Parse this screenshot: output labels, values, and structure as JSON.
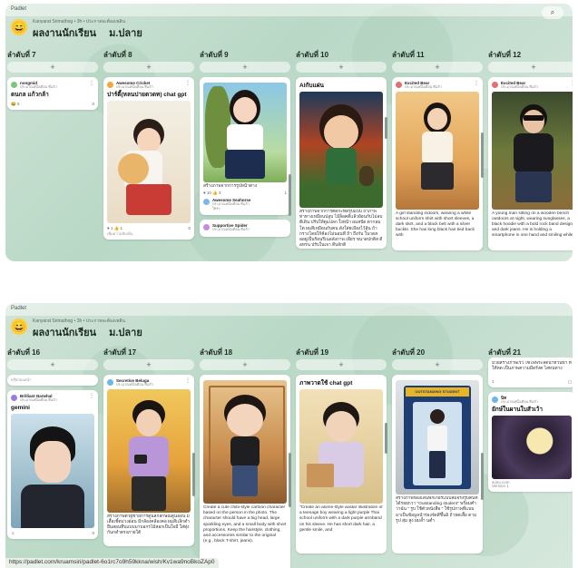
{
  "app_name": "Padlet",
  "search_icon": "search-icon",
  "breadcrumb": "Kanyarat Srimathog • 3h • ประกายจะต้องเพลิน",
  "board_title": "ผลงานนักเรียน  ม.ปลาย",
  "status_url": "https://padlet.com/kruamsiri/padlet-6o1rc7o9h59kkna/wish/Kv1wa9noBkoZAp0",
  "cards_preview": "ตรุ๊ปก่อนหน้า",
  "panel1": {
    "columns": [
      {
        "label": "ลำดับที่ 7"
      },
      {
        "label": "ลำดับที่ 8"
      },
      {
        "label": "ลำดับที่ 9"
      },
      {
        "label": "ลำดับที่ 10"
      },
      {
        "label": "ลำดับที่ 11"
      },
      {
        "label": "ลำดับที่ 12"
      }
    ],
    "cards": {
      "c7": {
        "author": "nongmid",
        "time": "ประมาณหนึ่งเดือน ที่แล้ว",
        "title": "ตนกล แก้วกล้า",
        "reactions": "😂 0",
        "comments": "0"
      },
      "c8": {
        "author": "Awesome Cricket",
        "time": "ประมาณหนึ่งเดือน ที่แล้ว",
        "title": "ปาร์ตี้(หลนปายตวดท) chat gpt",
        "reactions": "♥ 1 👍 1",
        "comments": "0",
        "comment_placeholder": "เพิ่มความคิดเห็น"
      },
      "c9a": {
        "caption": "สร้างภาพจากการรูปหน้าต่าง",
        "reactions": "♥ 10 👍 3",
        "comments": "1"
      },
      "c9b": {
        "author": "Awesome Seahorse",
        "time": "ประมาณหนึ่งเดือน ที่แล้ว",
        "title": "ใครๆ"
      },
      "c9c": {
        "author": "Supportive Spider",
        "time": "ประมาณหนึ่งเดือน ที่แล้ว"
      },
      "c10": {
        "title": "AIกับแผ่น",
        "body": "สร้างภาพจากการตัดกะทัดรูปแบบ ถ้าภาพ ท่าทางเหมือนปลูบ ไม้ล็อคดีแล้วย้อนกับไม่ลบตีเดิน ปรับให้ตูแปลก ใ่งหน้า ผมสปัด ตากลมโต ผมสีเหมือนกับคน ดังใส่ยเมืองไว้ลุ้น ถ้ากรางโดยใก้ค้องไม่นอนที่ ถ้า ถึงกับ ในวดส ออยู่เป็นร้อนรีเนลลังกาพ เพียร ขนาดปกติส ดีอหรน ปรับในเจา ดีบลักติ"
      },
      "c11": {
        "author": "Excited Bear",
        "time": "ประมาณหนึ่งเดือน ที่แล้ว",
        "body": "A girl standing indoors, wearing a white school uniform shirt with short sleeves, a dark skirt, and a black belt with a silver buckle. She has long black hair tied back with"
      },
      "c12": {
        "author": "Excited Bear",
        "time": "ประมาณหนึ่งเดือน ที่แล้ว",
        "body": "A young man sitting on a wooden bench outdoors at night, wearing sunglasses, a black hoodie with a bold rock band design, and dark jeans. He is holding a smartphone in one hand and smiling while"
      }
    }
  },
  "panel2": {
    "columns": [
      {
        "label": "ลำดับที่ 16"
      },
      {
        "label": "ลำดับที่ 17"
      },
      {
        "label": "ลำดับที่ 18"
      },
      {
        "label": "ลำดับที่ 19"
      },
      {
        "label": "ลำดับที่ 20"
      },
      {
        "label": "ลำดับที่ 21"
      }
    ],
    "cards": {
      "c16": {
        "author": "Brilliant Narwhal",
        "time": "ประมาณหนึ่งเดือน ที่แล้ว",
        "title": "gemini",
        "comments": "0"
      },
      "c17": {
        "author": "Secretive Beluga",
        "time": "ประมาณหนึ่งเดือน ที่แล้ว",
        "body": "สร้างภาพตัวผู้ชายการ์ตูนลึกลักษณ์ตูนออน มีเสื้อเชิ้ตม่วงอ่อน มีกล้องคล้องคอ ผมสีเเล็กดำ ยืนสอนทึบแบบมาบอกรไม้สอกเป็นใจมี ใส่ทุ่งกันกดำตรงภายใต้"
      },
      "c18": {
        "body": "Create a cute chibi-style cartoon character based on the person in the photo. The character should have a big head, large sparkling eyes, and a small body with short proportions. Keep the hairstyle, clothing, and accessories similar to the original (e.g., black T-shirt, jeans)."
      },
      "c19": {
        "title": "ภาพวาดใช้ chat gpt",
        "body": "\"Create an anime-style avatar illustration of a teenage boy wearing a light purple Thai school uniform with a dark purple armband on his sleeve. He has short dark hair, a gentle smile, and"
      },
      "c20": {
        "box_label": "OUTSTANDING STUDENT",
        "body": "สร้างภาพของเล่นฟิกเกอร์แบบสมจริงรูปคนที่ได้รอยกวา \"Outstanding student\" พร้อมคำว่าฉัน \" รูบ ใช้ตัวหนังสือ \" ใช้รูปภาพที่แนบมาเป็นข้อมูลนำร่องจัดสีขึ้นอิ ถ้าหดเสื้อ ตามรูป สุ่ม สูง ผมล้ำ นต่ำ"
      },
      "c21a": {
        "body": "ม้วยสร้างภาพเร็ว ไซไฟพระลัดน้ำท่วนข้า ที่ให้หด เป็นภาพความมืดรังค ไสทนทาง",
        "reactions": "1"
      },
      "c21b": {
        "author": "นิท",
        "time": "ประมาณหนึ่งเดือน ที่แล้ว",
        "title": "ยักษ์ในผานใบสัวเว้า",
        "site": "suno.com",
        "version": "Version 1"
      }
    }
  }
}
